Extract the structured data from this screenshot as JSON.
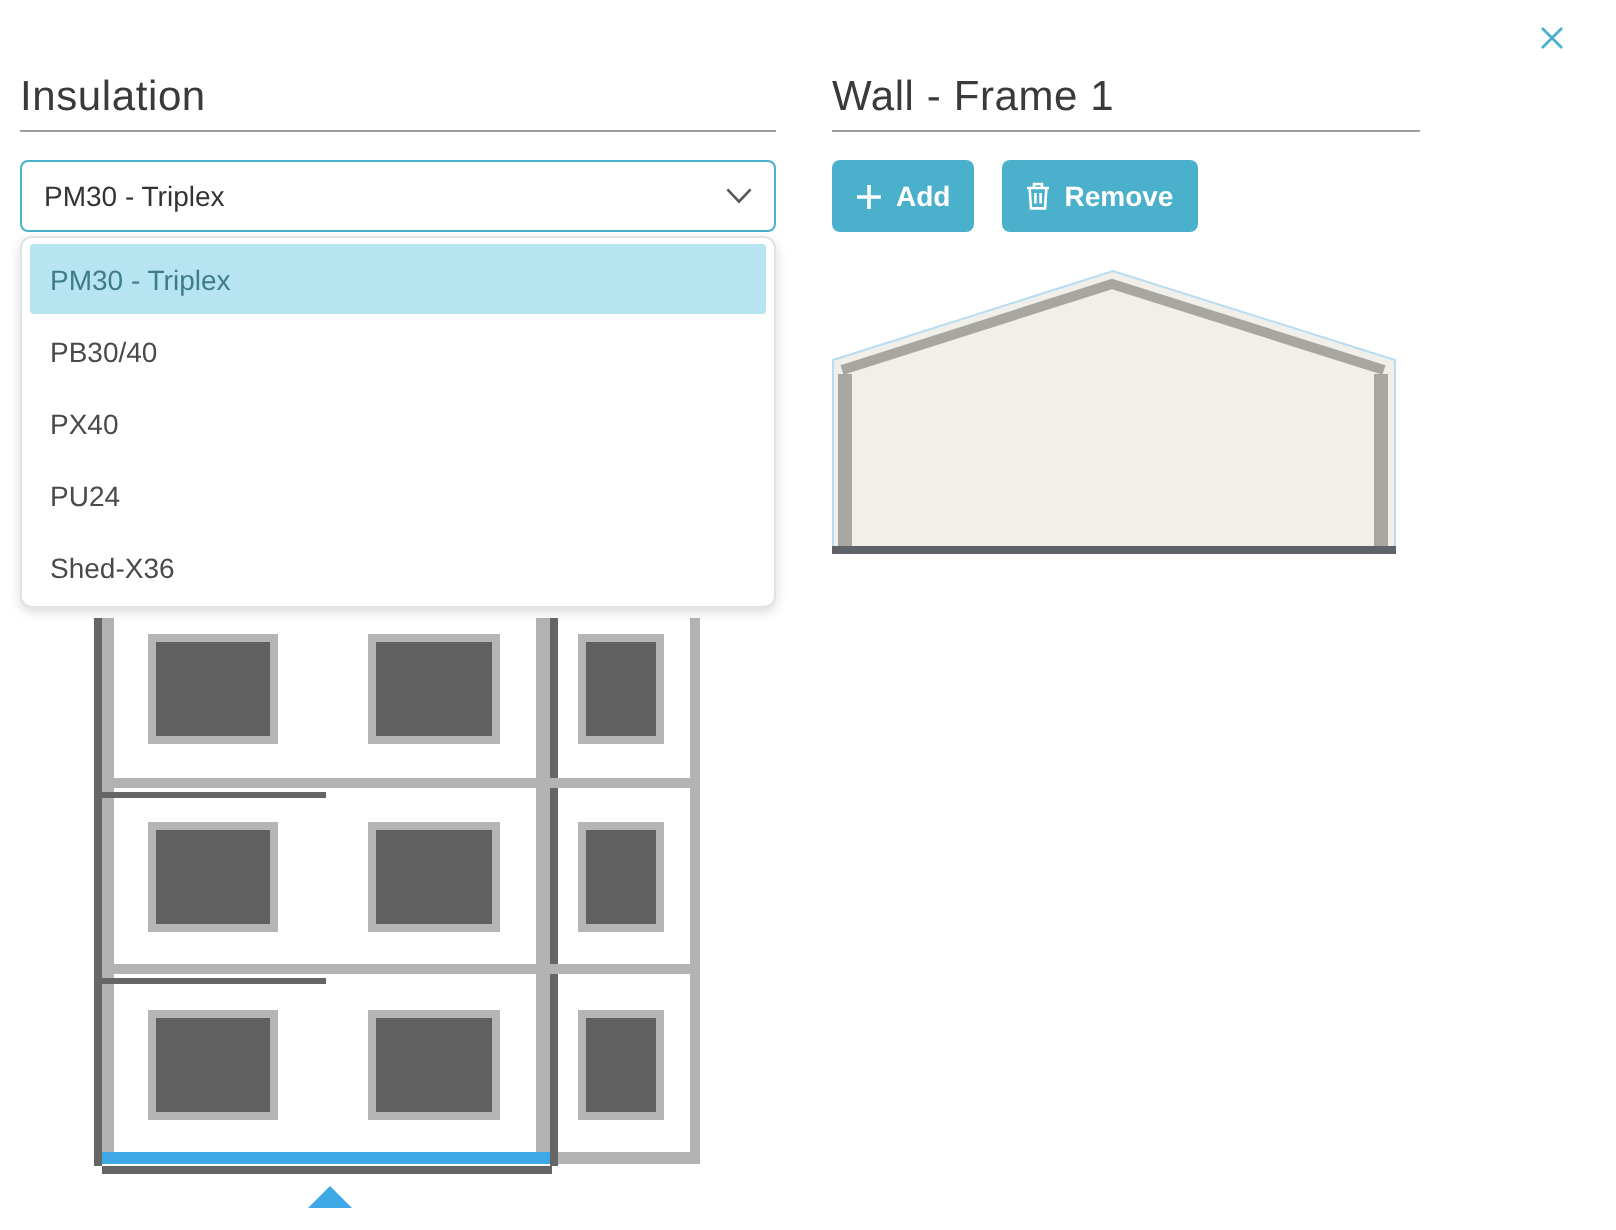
{
  "insulation": {
    "title": "Insulation",
    "select": {
      "value": "PM30 - Triplex",
      "expanded": true
    },
    "options": [
      {
        "label": "PM30 - Triplex",
        "selected": true
      },
      {
        "label": "PB30/40",
        "selected": false
      },
      {
        "label": "PX40",
        "selected": false
      },
      {
        "label": "PU24",
        "selected": false
      },
      {
        "label": "Shed-X36",
        "selected": false
      }
    ]
  },
  "wall": {
    "title": "Wall - Frame 1",
    "buttons": [
      {
        "kind": "add",
        "label": "Add"
      },
      {
        "kind": "remove",
        "label": "Remove"
      }
    ]
  }
}
